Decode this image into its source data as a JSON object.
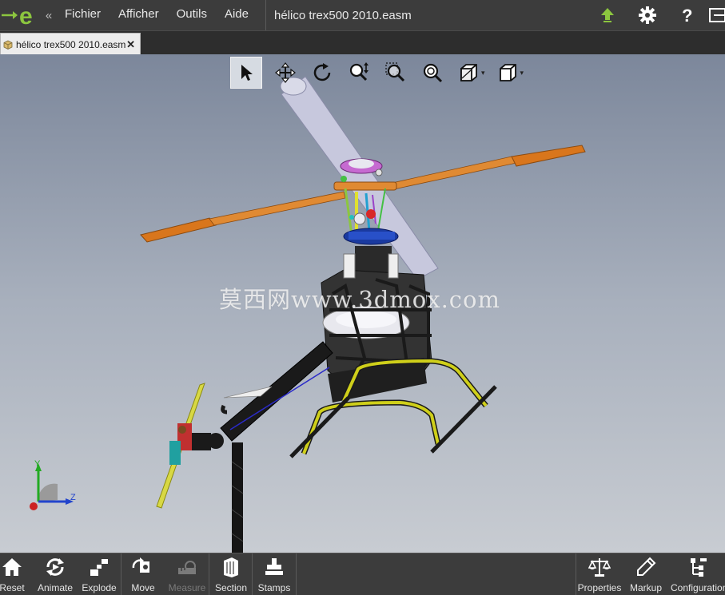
{
  "app": {
    "logo": "e",
    "collapse_glyph": "«"
  },
  "menu": {
    "items": [
      "Fichier",
      "Afficher",
      "Outils",
      "Aide"
    ]
  },
  "document": {
    "title": "hélico trex500 2010.easm",
    "tab_label": "hélico trex500 2010.easm",
    "tab_close": "✕"
  },
  "top_icons": [
    "upload-icon",
    "gear-icon",
    "help-icon",
    "minimize-icon"
  ],
  "view_toolbar": {
    "tools": [
      "select-tool",
      "pan-tool",
      "rotate-tool",
      "zoom-tool",
      "zoom-area-tool",
      "zoom-fit-tool",
      "display-style-tool",
      "view-orientation-tool"
    ],
    "active": "select-tool",
    "dropdown_glyph": "▾"
  },
  "watermark": "莫西网www.3dmox.com",
  "triad": {
    "y_label": "Y",
    "z_label": "Z"
  },
  "bottom_toolbar": {
    "items": [
      {
        "label": "Reset",
        "icon": "home-icon",
        "enabled": true
      },
      {
        "label": "Animate",
        "icon": "animate-icon",
        "enabled": true
      },
      {
        "label": "Explode",
        "icon": "explode-icon",
        "enabled": true
      },
      {
        "label": "Move",
        "icon": "move-icon",
        "enabled": true
      },
      {
        "label": "Measure",
        "icon": "measure-icon",
        "enabled": false
      },
      {
        "label": "Section",
        "icon": "section-icon",
        "enabled": true
      },
      {
        "label": "Stamps",
        "icon": "stamps-icon",
        "enabled": true
      },
      {
        "label": "Properties",
        "icon": "properties-icon",
        "enabled": true
      },
      {
        "label": "Markup",
        "icon": "markup-icon",
        "enabled": true
      },
      {
        "label": "Configurations",
        "icon": "configurations-icon",
        "enabled": true
      }
    ]
  },
  "colors": {
    "chrome": "#3c3c3c",
    "accent_green": "#8cc63f",
    "main_rotor": "#d9761c",
    "landing_skid": "#cfcf1a",
    "tail_rotor": "#d8d844"
  }
}
